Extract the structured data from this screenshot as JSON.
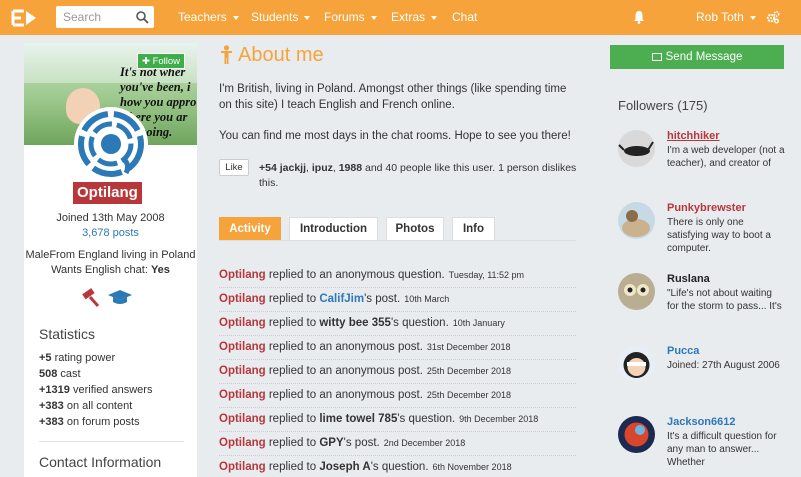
{
  "header": {
    "search_placeholder": "Search",
    "nav": [
      {
        "label": "Teachers",
        "has_caret": true
      },
      {
        "label": "Students",
        "has_caret": true
      },
      {
        "label": "Forums",
        "has_caret": true
      },
      {
        "label": "Extras",
        "has_caret": true
      },
      {
        "label": "Chat",
        "has_caret": false
      }
    ],
    "user_name": "Rob Toth",
    "accent_color": "#f5a33a"
  },
  "profile": {
    "cover_quote": [
      "It's not wher",
      "you've been, i",
      "how you appro",
      "where you ar",
      "going."
    ],
    "follow_label": "Follow",
    "username": "Optilang",
    "joined": "Joined 13th May 2008",
    "posts": "3,678 posts",
    "origin": "MaleFrom England living in Poland",
    "wants_english_label": "Wants English chat:",
    "wants_english_value": "Yes",
    "statistics_title": "Statistics",
    "stats": [
      {
        "value": "+5",
        "label": "rating power"
      },
      {
        "value": "508",
        "label": "cast"
      },
      {
        "value": "+1319",
        "label": "verified answers"
      },
      {
        "value": "+383",
        "label": "on all content"
      },
      {
        "value": "+383",
        "label": "on forum posts"
      }
    ],
    "contact_title": "Contact Information"
  },
  "about": {
    "title": "About me",
    "paragraph1": "I'm British, living in Poland. Amongst other things (like spending time on this site) I teach English and French online.",
    "paragraph2": "You can find me most days in the chat rooms. Hope to see you there!",
    "like_label": "Like",
    "like_count": "+54",
    "like_users": [
      "jackjj",
      "ipuz",
      "1988"
    ],
    "like_rest": "and 40 people like this user. 1 person dislikes this."
  },
  "tabs": [
    "Activity",
    "Introduction",
    "Photos",
    "Info"
  ],
  "activity": [
    {
      "user": "Optilang",
      "text": "replied to an anonymous question.",
      "target": "",
      "target_is_link": false,
      "suffix": "",
      "time": "Tuesday, 11:52 pm"
    },
    {
      "user": "Optilang",
      "text": "replied to",
      "target": "CalifJim",
      "target_is_link": true,
      "suffix": "'s post.",
      "time": "10th March"
    },
    {
      "user": "Optilang",
      "text": "replied to",
      "target": "witty bee 355",
      "target_is_link": false,
      "suffix": "'s question.",
      "time": "10th January"
    },
    {
      "user": "Optilang",
      "text": "replied to an anonymous post.",
      "target": "",
      "target_is_link": false,
      "suffix": "",
      "time": "31st December 2018"
    },
    {
      "user": "Optilang",
      "text": "replied to an anonymous post.",
      "target": "",
      "target_is_link": false,
      "suffix": "",
      "time": "25th December 2018"
    },
    {
      "user": "Optilang",
      "text": "replied to an anonymous post.",
      "target": "",
      "target_is_link": false,
      "suffix": "",
      "time": "25th December 2018"
    },
    {
      "user": "Optilang",
      "text": "replied to",
      "target": "lime towel 785",
      "target_is_link": false,
      "suffix": "'s question.",
      "time": "9th December 2018"
    },
    {
      "user": "Optilang",
      "text": "replied to",
      "target": "GPY",
      "target_is_link": false,
      "suffix": "'s post.",
      "time": "2nd December 2018"
    },
    {
      "user": "Optilang",
      "text": "replied to",
      "target": "Joseph A",
      "target_is_link": false,
      "suffix": "'s question.",
      "time": "6th November 2018"
    }
  ],
  "sidebar": {
    "send_message_label": "Send Message",
    "followers_title": "Followers (175)",
    "followers": [
      {
        "name": "hitchhiker",
        "style": "red-underline",
        "desc": "I'm a web developer (not a teacher), and creator of"
      },
      {
        "name": "Punkybrewster",
        "style": "red",
        "desc": "There is only one satisfying way to boot a computer."
      },
      {
        "name": "Ruslana",
        "style": "plain",
        "desc": "\"Life's not about waiting for the storm to pass... It's"
      },
      {
        "name": "Pucca",
        "style": "link",
        "desc": "Joined: 27th August 2006"
      },
      {
        "name": "Jackson6612",
        "style": "link",
        "desc": "It's a difficult question for any man to answer... Whether"
      }
    ]
  }
}
